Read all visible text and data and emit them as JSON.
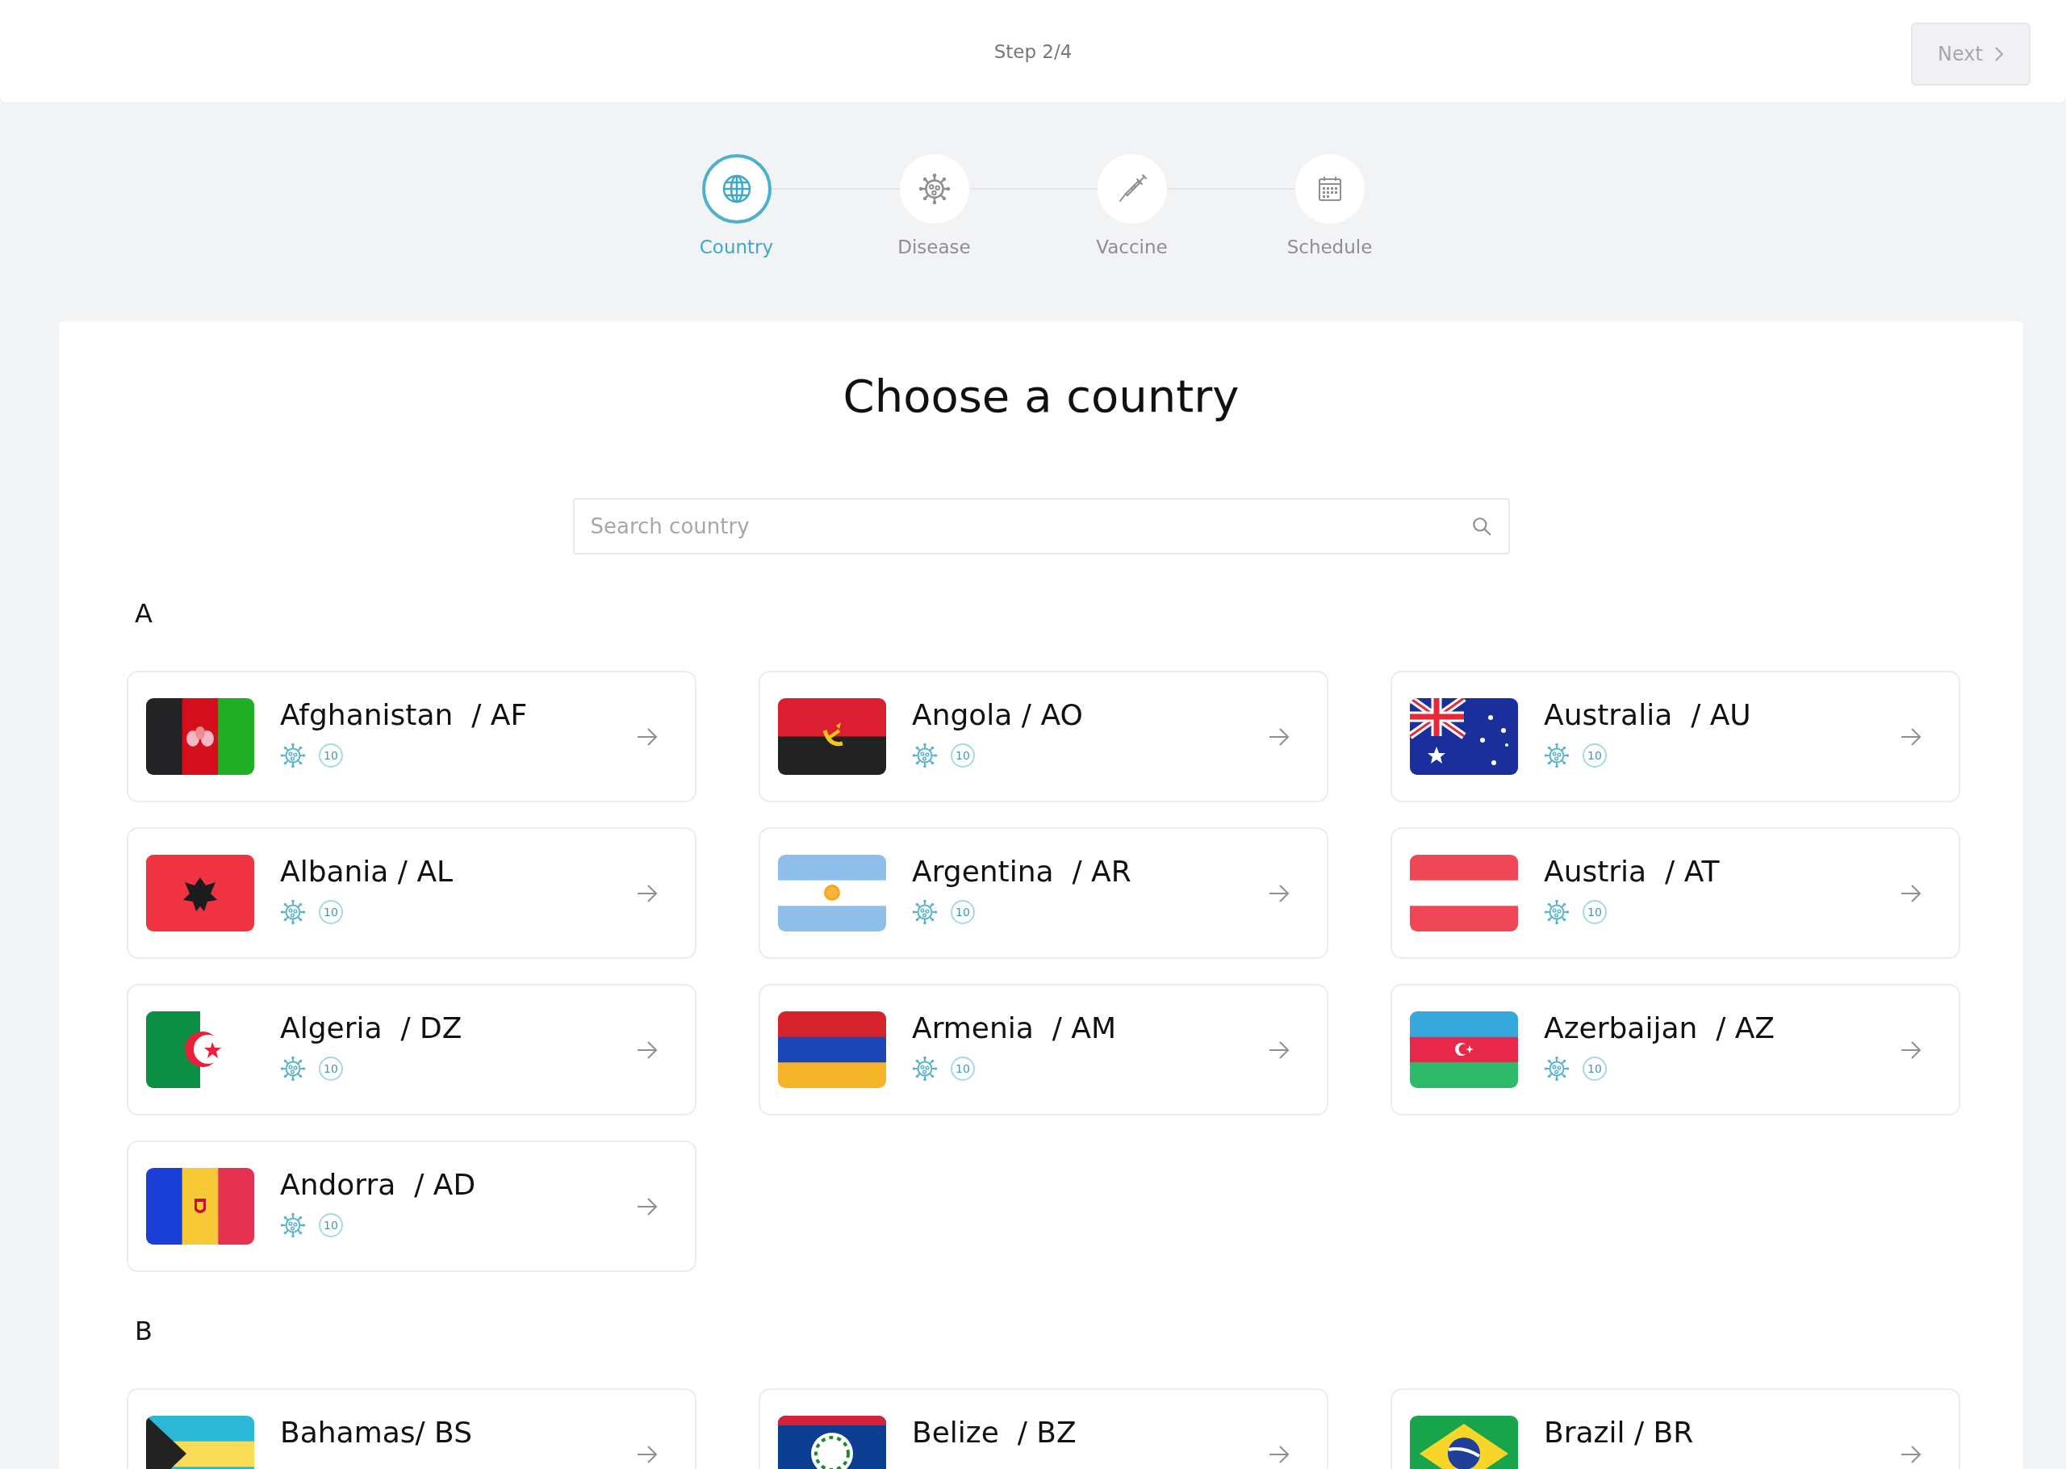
{
  "header": {
    "step": "Step 2/4",
    "next_button": {
      "label": "Next",
      "disabled": true
    }
  },
  "steps": [
    {
      "label": "Country",
      "selected": true
    },
    {
      "label": "Disease",
      "selected": false
    },
    {
      "label": "Vaccine",
      "selected": false
    },
    {
      "label": "Schedule",
      "selected": false
    }
  ],
  "title": "Choose a country",
  "search": {
    "placeholder": "Search country"
  },
  "sections": [
    {
      "letter": "A",
      "columns": [
        {
          "items": [
            {
              "name": "Afghanistan  / AF",
              "count": "10"
            },
            {
              "name": "Albania / AL",
              "count": "10"
            },
            {
              "name": "Algeria  / DZ",
              "count": "10"
            },
            {
              "name": "Andorra  / AD",
              "count": "10"
            }
          ]
        },
        {
          "items": [
            {
              "name": "Angola / AO",
              "count": "10"
            },
            {
              "name": "Argentina  / AR",
              "count": "10"
            },
            {
              "name": "Armenia  / AM",
              "count": "10"
            }
          ]
        },
        {
          "items": [
            {
              "name": "Australia  / AU",
              "count": "10"
            },
            {
              "name": "Austria  / AT",
              "count": "10"
            },
            {
              "name": "Azerbaijan  / AZ",
              "count": "10"
            }
          ]
        }
      ]
    },
    {
      "letter": "B",
      "columns": [
        {
          "items": [
            {
              "name": "Bahamas/ BS"
            }
          ]
        },
        {
          "items": [
            {
              "name": "Belize  / BZ"
            }
          ]
        },
        {
          "items": [
            {
              "name": "Brazil / BR"
            }
          ]
        }
      ]
    }
  ]
}
